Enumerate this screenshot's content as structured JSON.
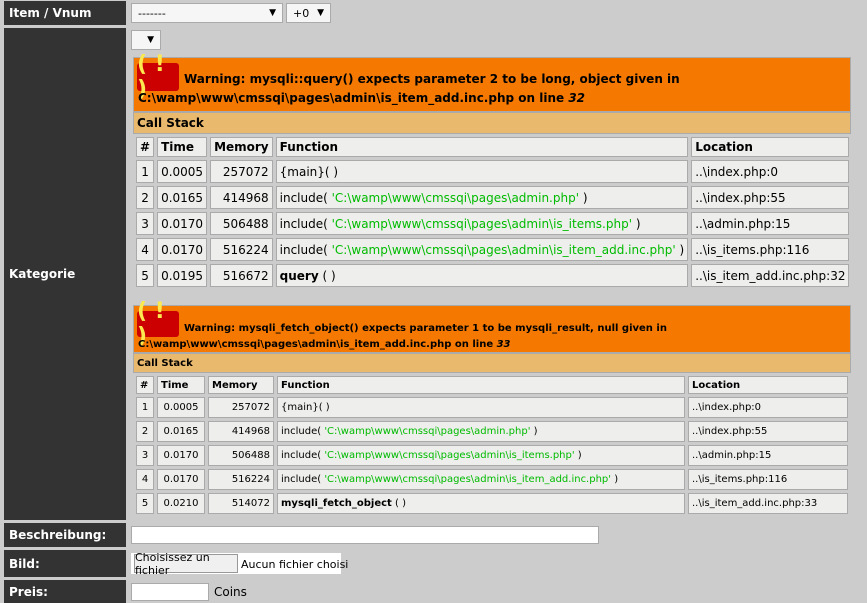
{
  "rows": {
    "item": {
      "label": "Item / Vnum",
      "select1": "-------",
      "select2": "+0"
    },
    "kategorie": {
      "label": "Kategorie"
    },
    "beschreibung": {
      "label": "Beschreibung:"
    },
    "bild": {
      "label": "Bild:",
      "button": "Choisissez un fichier",
      "status": "Aucun fichier choisi"
    },
    "preis": {
      "label": "Preis:",
      "unit": "Coins"
    }
  },
  "errors": [
    {
      "icon": "( ! )",
      "message": "Warning: mysqli::query() expects parameter 2 to be long, object given in",
      "path": "C:\\wamp\\www\\cmssqi\\pages\\admin\\is_item_add.inc.php on line ",
      "line": "32",
      "callstack": "Call Stack",
      "headers": [
        "#",
        "Time",
        "Memory",
        "Function",
        "Location"
      ],
      "rows": [
        {
          "n": "1",
          "time": "0.0005",
          "mem": "257072",
          "func": "{main}( )",
          "arg": "",
          "loc": "..\\index.php",
          "ln": "0"
        },
        {
          "n": "2",
          "time": "0.0165",
          "mem": "414968",
          "func": "include( ",
          "arg": "'C:\\wamp\\www\\cmssqi\\pages\\admin.php'",
          "close": " )",
          "loc": "..\\index.php",
          "ln": "55"
        },
        {
          "n": "3",
          "time": "0.0170",
          "mem": "506488",
          "func": "include( ",
          "arg": "'C:\\wamp\\www\\cmssqi\\pages\\admin\\is_items.php'",
          "close": " )",
          "loc": "..\\admin.php",
          "ln": "15"
        },
        {
          "n": "4",
          "time": "0.0170",
          "mem": "516224",
          "func": "include( ",
          "arg": "'C:\\wamp\\www\\cmssqi\\pages\\admin\\is_item_add.inc.php'",
          "close": " )",
          "loc": "..\\is_items.php",
          "ln": "116"
        },
        {
          "n": "5",
          "time": "0.0195",
          "mem": "516672",
          "func": "query",
          "close": " ( )",
          "loc": "..\\is_item_add.inc.php",
          "ln": "32"
        }
      ]
    },
    {
      "icon": "( ! )",
      "message": "Warning: mysqli_fetch_object() expects parameter 1 to be mysqli_result, null given in",
      "path": "C:\\wamp\\www\\cmssqi\\pages\\admin\\is_item_add.inc.php on line ",
      "line": "33",
      "callstack": "Call Stack",
      "headers": [
        "#",
        "Time",
        "Memory",
        "Function",
        "Location"
      ],
      "rows": [
        {
          "n": "1",
          "time": "0.0005",
          "mem": "257072",
          "func": "{main}( )",
          "arg": "",
          "loc": "..\\index.php",
          "ln": "0"
        },
        {
          "n": "2",
          "time": "0.0165",
          "mem": "414968",
          "func": "include( ",
          "arg": "'C:\\wamp\\www\\cmssqi\\pages\\admin.php'",
          "close": " )",
          "loc": "..\\index.php",
          "ln": "55"
        },
        {
          "n": "3",
          "time": "0.0170",
          "mem": "506488",
          "func": "include( ",
          "arg": "'C:\\wamp\\www\\cmssqi\\pages\\admin\\is_items.php'",
          "close": " )",
          "loc": "..\\admin.php",
          "ln": "15"
        },
        {
          "n": "4",
          "time": "0.0170",
          "mem": "516224",
          "func": "include( ",
          "arg": "'C:\\wamp\\www\\cmssqi\\pages\\admin\\is_item_add.inc.php'",
          "close": " )",
          "loc": "..\\is_items.php",
          "ln": "116"
        },
        {
          "n": "5",
          "time": "0.0210",
          "mem": "514072",
          "func": "mysqli_fetch_object",
          "close": " ( )",
          "loc": "..\\is_item_add.inc.php",
          "ln": "33"
        }
      ]
    }
  ]
}
